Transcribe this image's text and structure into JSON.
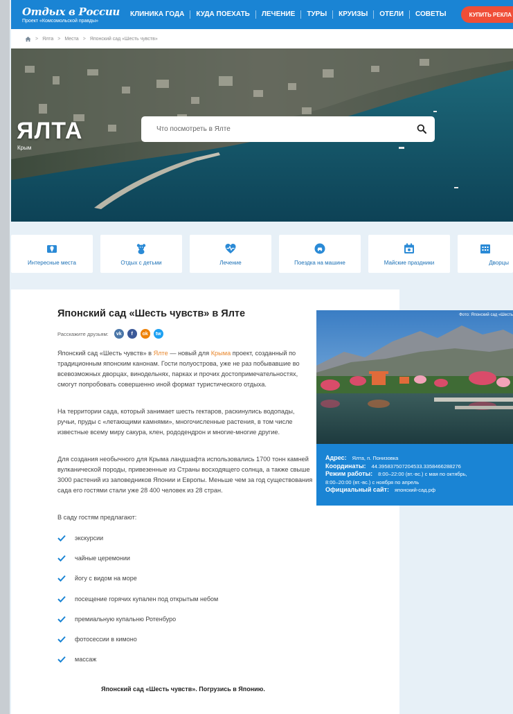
{
  "header": {
    "logo_title": "Отдых в России",
    "logo_sub": "Проект «Комсомольской правды»",
    "nav": [
      "КЛИНИКА ГОДА",
      "КУДА ПОЕХАТЬ",
      "ЛЕЧЕНИЕ",
      "ТУРЫ",
      "КРУИЗЫ",
      "ОТЕЛИ",
      "СОВЕТЫ"
    ],
    "buy_ad": "КУПИТЬ РЕКЛА"
  },
  "breadcrumb": [
    "Ялта",
    "Места",
    "Японский сад «Шесть чувств»"
  ],
  "hero": {
    "city": "ЯЛТА",
    "region": "Крым",
    "search_placeholder": "Что посмотреть в Ялте"
  },
  "categories": [
    {
      "label": "Интересные места",
      "icon": "map-pin-icon"
    },
    {
      "label": "Отдых с детьми",
      "icon": "teddy-bear-icon"
    },
    {
      "label": "Лечение",
      "icon": "heart-pulse-icon"
    },
    {
      "label": "Поездка на машине",
      "icon": "car-icon"
    },
    {
      "label": "Майские праздники",
      "icon": "calendar-icon"
    },
    {
      "label": "Дворцы",
      "icon": "palace-icon"
    }
  ],
  "article": {
    "title": "Японский сад «Шесть чувств» в Ялте",
    "share_label": "Расскажите друзьям:",
    "share_buttons": [
      "vk",
      "f",
      "ok",
      "tw"
    ],
    "p1_a": "Японский сад «Шесть чувств» в ",
    "p1_link1": "Ялте",
    "p1_b": " — новый для ",
    "p1_link2": "Крыма",
    "p1_c": " проект, созданный по традиционным японским канонам. Гости полуострова, уже не раз побывавшие во всевозможных дворцах, винодельнях, парках и прочих достопримечательностях, смогут попробовать совершенно иной формат туристического отдыха.",
    "p2": "На территории сада, который занимает шесть гектаров, раскинулись водопады, ручьи, пруды с «летающими камнями», многочисленные растения, в том числе известные всему миру сакура, клен, рододендрон и многие-многие другие.",
    "p3": "Для создания необычного для Крыма ландшафта использовались 1700 тонн камней вулканической породы, привезенные из Страны восходящего солнца, а также свыше 3000 растений из заповедников Японии и Европы. Меньше чем за год существования сада его гостями стали уже 28 400 человек из 28 стран.",
    "p4": "В саду гостям предлагают:",
    "offers": [
      "экскурсии",
      "чайные церемонии",
      "йогу с видом на море",
      "посещение горячих купален под открытым небом",
      "премиальную купальню Ротенбуро",
      "фотосессии в кимоно",
      "массаж"
    ],
    "caption": "Японский сад «Шесть чувств». Погрузись в Японию."
  },
  "photo": {
    "credit": "Фото: Японский сад «Шесть"
  },
  "info": {
    "address_key": "Адрес:",
    "address_val": "Ялта, п. Понизовка",
    "coords_key": "Координаты:",
    "coords_val": "44.395837507204533.3358466288276",
    "hours_key": "Режим работы:",
    "hours_val1": "8:00–22:00 (вт.-вс.) с мая по октябрь,",
    "hours_val2": "8:00–20:00 (вт.-вс.) с ноября по апрель",
    "site_key": "Официальный сайт:",
    "site_val": "японский-сад.рф"
  },
  "colors": {
    "brand": "#1a84d4",
    "accent": "#f04e37",
    "link": "#e8862b"
  }
}
